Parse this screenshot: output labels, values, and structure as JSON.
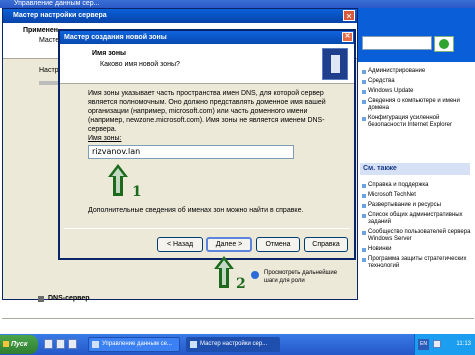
{
  "outer_window": {
    "title": "Управление данным сер..."
  },
  "wizard": {
    "title": "Мастер настройки сервера",
    "heading": "Применен",
    "subheading": "Мастер",
    "side_label": "Настро",
    "close_glyph": "✕"
  },
  "dialog": {
    "title": "Мастер создания новой зоны",
    "close_glyph": "✕",
    "header_title": "Имя зоны",
    "header_subtitle": "Каково имя новой зоны?",
    "description": "Имя зоны указывает часть пространства имен DNS, для которой сервер является полномочным. Оно должно представлять доменное имя вашей организации (например, microsoft.com) или часть доменного имени (например, newzone.microsoft.com). Имя зоны не является именем DNS-сервера.",
    "zone_label": "Имя зоны:",
    "zone_value": "rizvanov.lan",
    "help_text": "Дополнительные сведения об именах зон можно найти в справке.",
    "buttons": {
      "back": "< Назад",
      "next": "Далее >",
      "cancel": "Отмена",
      "help": "Справка"
    }
  },
  "annotations": {
    "arrow1": "1",
    "arrow2": "2"
  },
  "right_pane": {
    "items": [
      "Администрирование",
      "Средства",
      "Windows Update",
      "Сведения о компьютере и имени домена",
      "Конфигурация усиленной безопасности Internet Explorer"
    ],
    "see_also_header": "См. также",
    "see_also_items": [
      "Справка и поддержка",
      "Microsoft TechNet",
      "Развертывание и ресурсы",
      "Список общих административных заданий",
      "Сообщество пользователей сервера Windows Server",
      "Новинки",
      "Программа защиты стратегических технологий"
    ]
  },
  "main_area": {
    "next_steps": "Просмотреть дальнейшие шаги для роли",
    "dns_server": "DNS-сервер"
  },
  "taskbar": {
    "start": "Пуск",
    "tasks": [
      "Управление данным се...",
      "Мастер настройки сер..."
    ],
    "lang": "EN",
    "clock": "11:13"
  }
}
